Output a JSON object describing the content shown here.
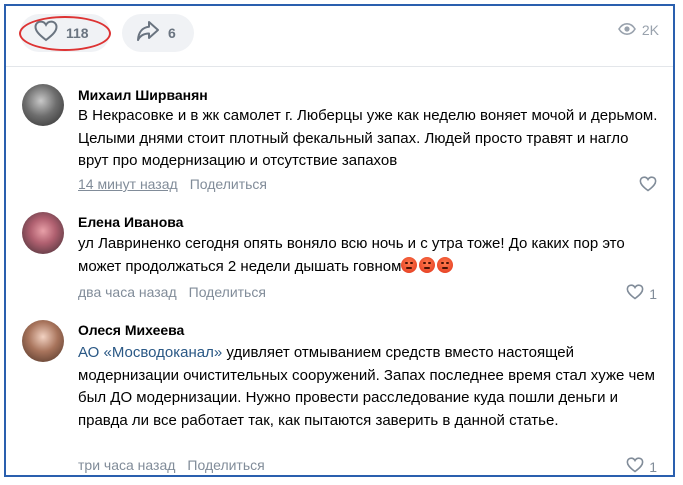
{
  "post_actions": {
    "likes": "118",
    "shares": "6",
    "views": "2K"
  },
  "comments": [
    {
      "author": "Михаил Ширванян",
      "text": "В Некрасовке и в жк самолет г. Люберцы уже как неделю воняет мочой и дерьмом. Целыми днями стоит плотный фекальный запах. Людей просто травят и нагло врут про модернизацию и отсутствие запахов",
      "time": "14 минут назад",
      "share_label": "Поделиться",
      "likes": ""
    },
    {
      "author": "Елена Иванова",
      "text": "ул Лавриненко сегодня опять воняло всю ночь и с утра тоже! До каких пор это может продолжаться 2 недели дышать говном",
      "emoji": "angry-face-emoji x3",
      "time": "два часа назад",
      "share_label": "Поделиться",
      "likes": "1"
    },
    {
      "author": "Олеся Михеева",
      "mention": "АО «Мосводоканал»",
      "text": " удивляет отмыванием средств вместо настоящей модернизации очистительных сооружений. Запах последнее время стал хуже чем был ДО модернизации. Нужно провести расследование куда пошли деньги и правда ли все работает так, как пытаются заверить в данной статье.",
      "time": "три часа назад",
      "share_label": "Поделиться",
      "likes": "1"
    }
  ],
  "colors": {
    "frame_border": "#2a5fae",
    "highlight_ring": "#dd3333",
    "link": "#2a5885",
    "meta": "#818c99"
  }
}
